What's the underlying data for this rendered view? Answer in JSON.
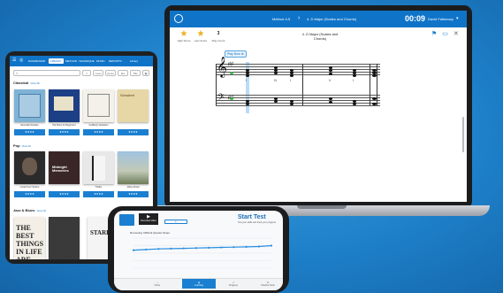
{
  "laptop": {
    "header": {
      "breadcrumb_method": "Method 4-5",
      "breadcrumb_exercise": "4. D Major (Scales and Chords)",
      "timer": "00:09",
      "user": "David Falkenary"
    },
    "stats": {
      "high_score_value": "",
      "high_score_label": "High Score",
      "last_score_label": "Last Score",
      "play_count_value": "3",
      "play_count_label": "Play Count"
    },
    "title_line1": "4. D Major (Scales and",
    "title_line2": "Chords)",
    "play_now": "Play Now",
    "chords": [
      "I",
      "IV",
      "I",
      "V",
      "I"
    ],
    "icon_names": [
      "logo-icon",
      "star-icon",
      "flag-icon",
      "monitor-icon",
      "close-icon"
    ],
    "accent": "#0f74c8"
  },
  "tablet": {
    "nav": [
      "DASHBOARD",
      "LIBRARY",
      "METHOD",
      "TECHNIQUE",
      "MUSIC",
      "REPORTS",
      "Library"
    ],
    "search_placeholder": "",
    "filters": [
      "Level",
      "Genre",
      "Era",
      "Title"
    ],
    "classical": {
      "heading": "Classical",
      "see_all": "View All",
      "books": [
        {
          "title": "Essential Sonatas",
          "sub": "",
          "cta": "★★★★"
        },
        {
          "title": "Hal Piano for Beginners",
          "sub": "",
          "cta": "★★★★"
        },
        {
          "title": "Goldberg Variations",
          "sub": "",
          "cta": "★★★★"
        },
        {
          "title": "Schubert",
          "sub": "",
          "cta": "★★★★"
        }
      ]
    },
    "pop": {
      "heading": "Pop",
      "see_all": "View All",
      "books": [
        {
          "title": "Lorde Pure Heroine",
          "cta": "★★★★"
        },
        {
          "title": "Midnight Memories",
          "cta": "★★★★"
        },
        {
          "title": "Thriller",
          "cta": "★★★★"
        },
        {
          "title": "Abbey Road",
          "cta": "★★★★"
        }
      ]
    },
    "jazz": {
      "heading": "Jazz & Blues",
      "see_all": "View All",
      "book1_text": "THE BEST THINGS IN LIFE ARE FREE",
      "book2_text": "STARDUST"
    }
  },
  "phone": {
    "video_label": "Recorded Video",
    "start_test": "Start Test",
    "start_sub": "Test your skills and track your progress",
    "chart_title": "Drumming: Difficult Quarter Notes",
    "tabs": [
      "Home",
      "Learning",
      "Progress",
      "Practice Tools"
    ],
    "active_tab": 1
  },
  "chart_data": {
    "type": "line",
    "title": "",
    "x": [
      1,
      2,
      3,
      4,
      5,
      6,
      7,
      8,
      9,
      10,
      11,
      12
    ],
    "values": [
      60,
      62,
      64,
      65,
      66,
      67,
      68,
      69,
      70,
      71,
      72,
      75
    ],
    "xlabel": "",
    "ylabel": "",
    "ylim": [
      0,
      100
    ],
    "color": "#2a8fe0"
  }
}
